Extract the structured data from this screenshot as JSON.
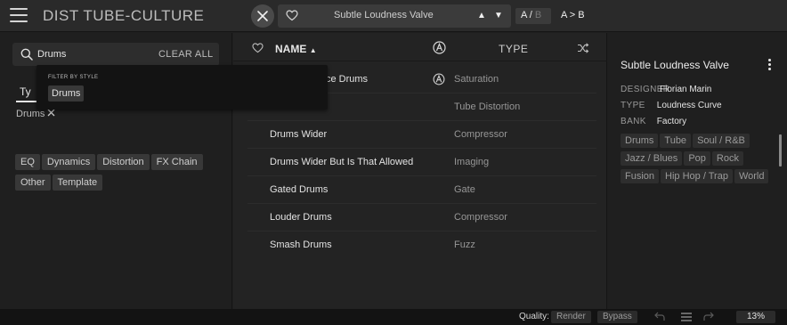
{
  "app": {
    "title": "DIST TUBE-CULTURE"
  },
  "topbar": {
    "preset_name": "Subtle Loudness Valve",
    "ab_a": "A",
    "ab_sep": " / ",
    "ab_b": "B",
    "ab_copy": "A > B"
  },
  "search": {
    "value": "Drums",
    "placeholder": "Search",
    "clear_label": "CLEAR ALL"
  },
  "filters": {
    "tab_label": "Ty",
    "active_filter": "Drums",
    "popup_header": "FILTER BY STYLE",
    "popup_chip": "Drums",
    "chips": [
      "EQ",
      "Dynamics",
      "Distortion",
      "FX Chain",
      "Other",
      "Template"
    ]
  },
  "list": {
    "header_name": "NAME",
    "header_type": "TYPE",
    "rows": [
      {
        "name": "ce Drums",
        "type": "Saturation",
        "factory": true
      },
      {
        "name": "",
        "type": "Tube Distortion",
        "factory": false
      },
      {
        "name": "Drums Wider",
        "type": "Compressor",
        "factory": false
      },
      {
        "name": "Drums Wider But Is That Allowed",
        "type": "Imaging",
        "factory": false
      },
      {
        "name": "Gated Drums",
        "type": "Gate",
        "factory": false
      },
      {
        "name": "Louder Drums",
        "type": "Compressor",
        "factory": false
      },
      {
        "name": "Smash Drums",
        "type": "Fuzz",
        "factory": false
      }
    ]
  },
  "info": {
    "title": "Subtle Loudness Valve",
    "designer_label": "DESIGNER",
    "designer": "Florian Marin",
    "type_label": "TYPE",
    "type": "Loudness Curve",
    "bank_label": "BANK",
    "bank": "Factory",
    "styles": [
      "Drums",
      "Tube",
      "Soul / R&B",
      "Jazz / Blues",
      "Pop",
      "Rock",
      "Fusion",
      "Hip Hop / Trap",
      "World"
    ]
  },
  "bottombar": {
    "quality_label": "Quality:",
    "render_label": "Render",
    "bypass_label": "Bypass",
    "cpu": "13%"
  },
  "icons": {
    "menu": "hamburger-icon",
    "close": "close-icon",
    "heart": "heart-icon",
    "search": "search-icon",
    "arturia": "arturia-logo-icon",
    "shuffle": "shuffle-icon",
    "undo": "undo-icon",
    "redo": "redo-icon",
    "history": "history-icon",
    "more": "kebab-icon"
  }
}
